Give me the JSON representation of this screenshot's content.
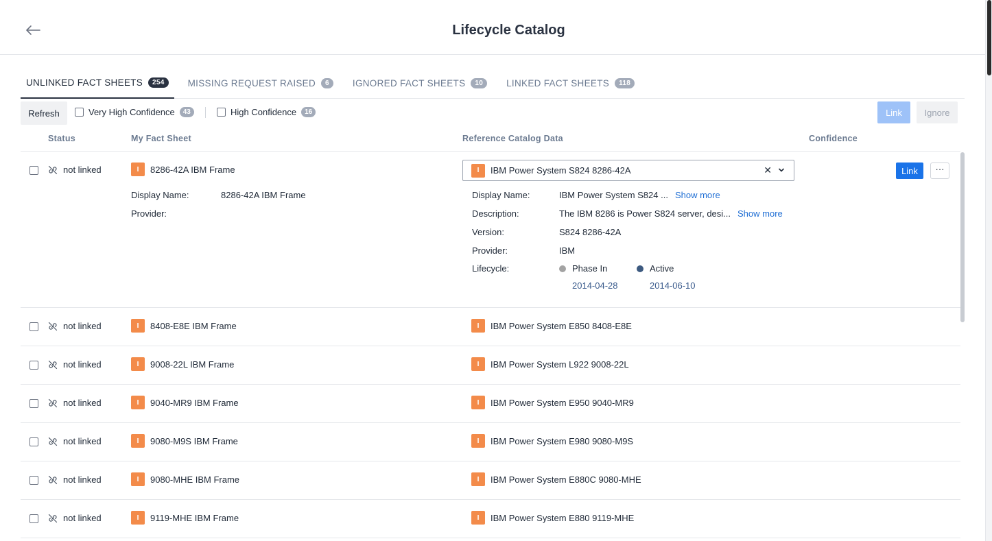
{
  "header": {
    "title": "Lifecycle Catalog"
  },
  "tabs": [
    {
      "label": "UNLINKED FACT SHEETS",
      "count": "254",
      "active": true
    },
    {
      "label": "MISSING REQUEST RAISED",
      "count": "6"
    },
    {
      "label": "IGNORED FACT SHEETS",
      "count": "10"
    },
    {
      "label": "LINKED FACT SHEETS",
      "count": "118"
    }
  ],
  "toolbar": {
    "refresh_label": "Refresh",
    "very_high_label": "Very High Confidence",
    "very_high_count": "43",
    "high_label": "High Confidence",
    "high_count": "16",
    "link_label": "Link",
    "ignore_label": "Ignore"
  },
  "columns": {
    "status": "Status",
    "my_fact_sheet": "My Fact Sheet",
    "reference": "Reference Catalog Data",
    "confidence": "Confidence"
  },
  "icon_letter": "I",
  "expanded": {
    "status": "not linked",
    "fact_name": "8286-42A IBM Frame",
    "fact_display_label": "Display Name:",
    "fact_display_value": "8286-42A IBM Frame",
    "fact_provider_label": "Provider:",
    "ref_selected": "IBM Power System S824 8286-42A",
    "ref_display_label": "Display Name:",
    "ref_display_value": "IBM Power System S824 ...",
    "show_more": "Show more",
    "ref_desc_label": "Description:",
    "ref_desc_value": "The IBM 8286 is Power S824 server, desi...",
    "ref_version_label": "Version:",
    "ref_version_value": "S824 8286-42A",
    "ref_provider_label": "Provider:",
    "ref_provider_value": "IBM",
    "ref_lifecycle_label": "Lifecycle:",
    "phase_in_label": "Phase In",
    "phase_in_date": "2014-04-28",
    "active_label": "Active",
    "active_date": "2014-06-10",
    "link_label": "Link",
    "more_label": "···"
  },
  "rows": [
    {
      "status": "not linked",
      "fact": "8408-E8E IBM Frame",
      "ref": "IBM Power System E850 8408-E8E"
    },
    {
      "status": "not linked",
      "fact": "9008-22L IBM Frame",
      "ref": "IBM Power System L922 9008-22L"
    },
    {
      "status": "not linked",
      "fact": "9040-MR9 IBM Frame",
      "ref": "IBM Power System E950 9040-MR9"
    },
    {
      "status": "not linked",
      "fact": "9080-M9S IBM Frame",
      "ref": "IBM Power System E980 9080-M9S"
    },
    {
      "status": "not linked",
      "fact": "9080-MHE IBM Frame",
      "ref": "IBM Power System E880C 9080-MHE"
    },
    {
      "status": "not linked",
      "fact": "9119-MHE IBM Frame",
      "ref": "IBM Power System E880 9119-MHE"
    }
  ],
  "colors": {
    "accent": "#1a73e8",
    "fact_icon": "#f38b4a",
    "phase_in_dot": "#a3a3a3",
    "active_dot": "#3d5a80"
  },
  "icons": {
    "back": "arrow-left-icon",
    "unlinked": "link-off-icon",
    "dropdown": "chevron-down-icon",
    "clear": "close-icon"
  }
}
